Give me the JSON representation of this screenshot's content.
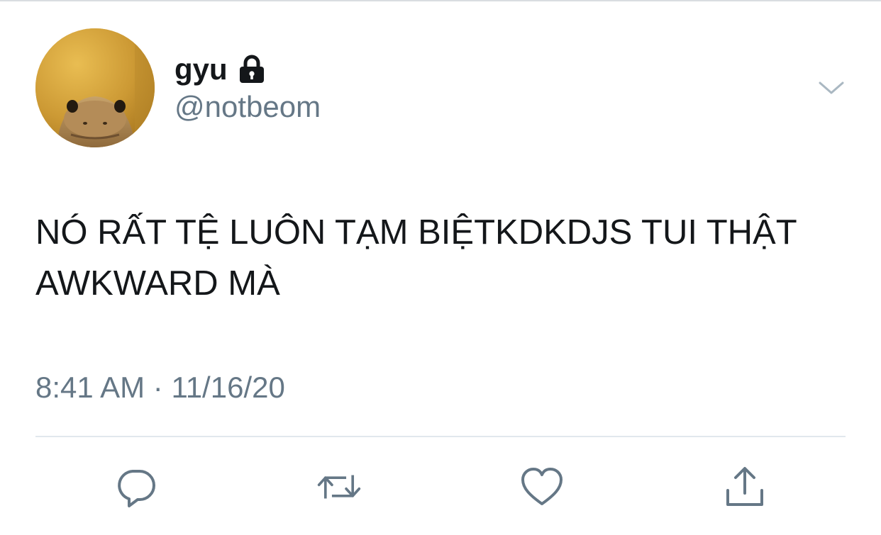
{
  "user": {
    "display_name": "gyu",
    "handle": "@notbeom",
    "protected_icon": "lock-icon",
    "avatar_icon": "lizard-avatar"
  },
  "tweet": {
    "text": "NÓ RẤT TỆ LUÔN TẠM BIỆTKDKDJS TUI THẬT\nAWKWARD MÀ",
    "time": "8:41 AM",
    "separator": "·",
    "date": "11/16/20"
  },
  "actions": [
    {
      "icon": "reply-icon"
    },
    {
      "icon": "retweet-icon"
    },
    {
      "icon": "like-icon"
    },
    {
      "icon": "share-icon"
    }
  ],
  "colors": {
    "text_primary": "#14171a",
    "text_secondary": "#657786",
    "icon_gray": "#657786",
    "divider": "#e1e8ed"
  }
}
